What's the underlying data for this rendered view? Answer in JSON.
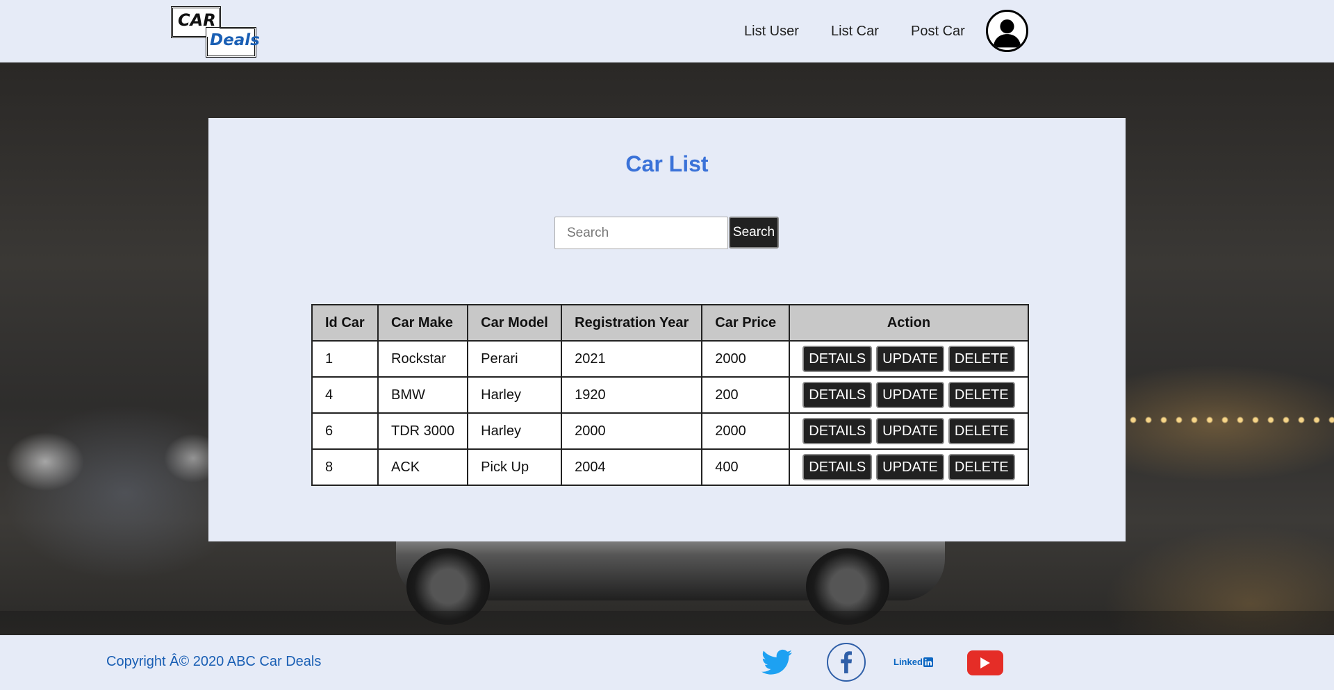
{
  "header": {
    "logo": {
      "top": "CAR",
      "bottom": "Deals"
    },
    "nav": [
      {
        "label": "List User"
      },
      {
        "label": "List Car"
      },
      {
        "label": "Post Car"
      }
    ],
    "avatar_icon": "user-avatar-icon"
  },
  "main": {
    "title": "Car List",
    "search": {
      "placeholder": "Search",
      "value": "",
      "button_label": "Search"
    },
    "table": {
      "columns": [
        "Id Car",
        "Car Make",
        "Car Model",
        "Registration Year",
        "Car Price",
        "Action"
      ],
      "actions": [
        "DETAILS",
        "UPDATE",
        "DELETE"
      ],
      "rows": [
        {
          "id": "1",
          "make": "Rockstar",
          "model": "Perari",
          "year": "2021",
          "price": "2000"
        },
        {
          "id": "4",
          "make": "BMW",
          "model": "Harley",
          "year": "1920",
          "price": "200"
        },
        {
          "id": "6",
          "make": "TDR 3000",
          "model": "Harley",
          "year": "2000",
          "price": "2000"
        },
        {
          "id": "8",
          "make": "ACK",
          "model": "Pick Up",
          "year": "2004",
          "price": "400"
        }
      ]
    }
  },
  "footer": {
    "copyright": "Copyright Â© 2020 ABC Car Deals",
    "social": [
      {
        "icon": "twitter-icon",
        "color": "#1da1f2"
      },
      {
        "icon": "facebook-icon",
        "color": "#2f5fa8"
      },
      {
        "icon": "linkedin-icon",
        "label": "Linked",
        "color": "#0a66c2"
      },
      {
        "icon": "youtube-icon",
        "color": "#e52d27"
      }
    ]
  },
  "colors": {
    "background": "#e6ebf7",
    "accent": "#3a72d8",
    "button": "#212121"
  }
}
